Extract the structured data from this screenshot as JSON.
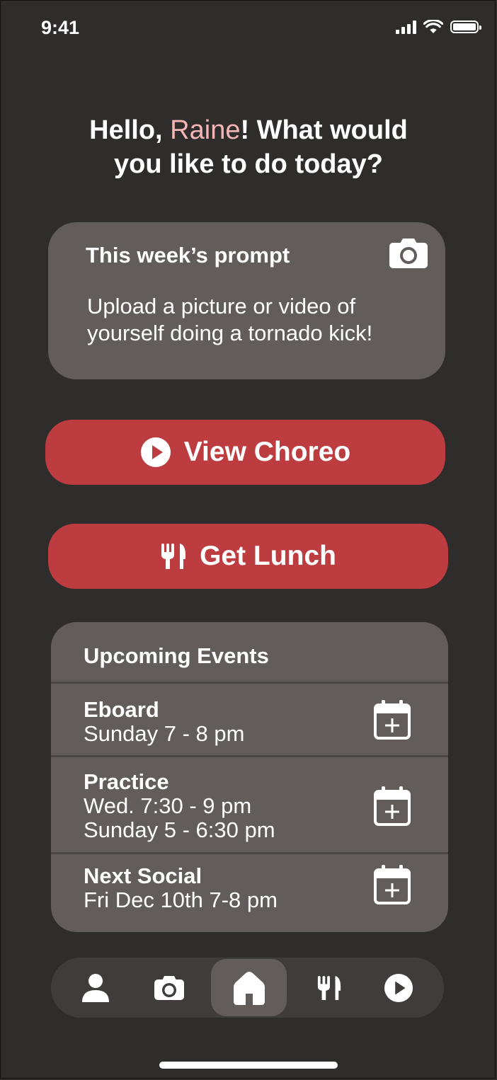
{
  "status_bar": {
    "time": "9:41"
  },
  "greeting": {
    "prefix": "Hello, ",
    "name": "Raine",
    "suffix_line1": "! What would",
    "line2": "you like to do today?"
  },
  "prompt_card": {
    "title": "This week’s prompt",
    "text": "Upload a picture or video of yourself doing a tornado kick!"
  },
  "actions": {
    "view_choreo": "View Choreo",
    "get_lunch": "Get Lunch"
  },
  "events": {
    "header": "Upcoming Events",
    "items": [
      {
        "title": "Eboard",
        "times": [
          "Sunday 7 - 8 pm"
        ]
      },
      {
        "title": "Practice",
        "times": [
          "Wed. 7:30 - 9 pm",
          "Sunday 5 - 6:30 pm"
        ]
      },
      {
        "title": "Next Social",
        "times": [
          "Fri Dec 10th 7-8 pm"
        ]
      }
    ]
  },
  "tabbar": {
    "tabs": [
      {
        "icon": "person-icon",
        "active": false
      },
      {
        "icon": "camera-icon",
        "active": false
      },
      {
        "icon": "home-icon",
        "active": true
      },
      {
        "icon": "fork-knife-icon",
        "active": false
      },
      {
        "icon": "play-icon",
        "active": false
      }
    ]
  },
  "colors": {
    "background": "#2f2c2c",
    "card": "#625d5b",
    "accent_red": "#bc3c40",
    "name_pink": "#f4b5b5",
    "tabbar": "#403c3b"
  }
}
